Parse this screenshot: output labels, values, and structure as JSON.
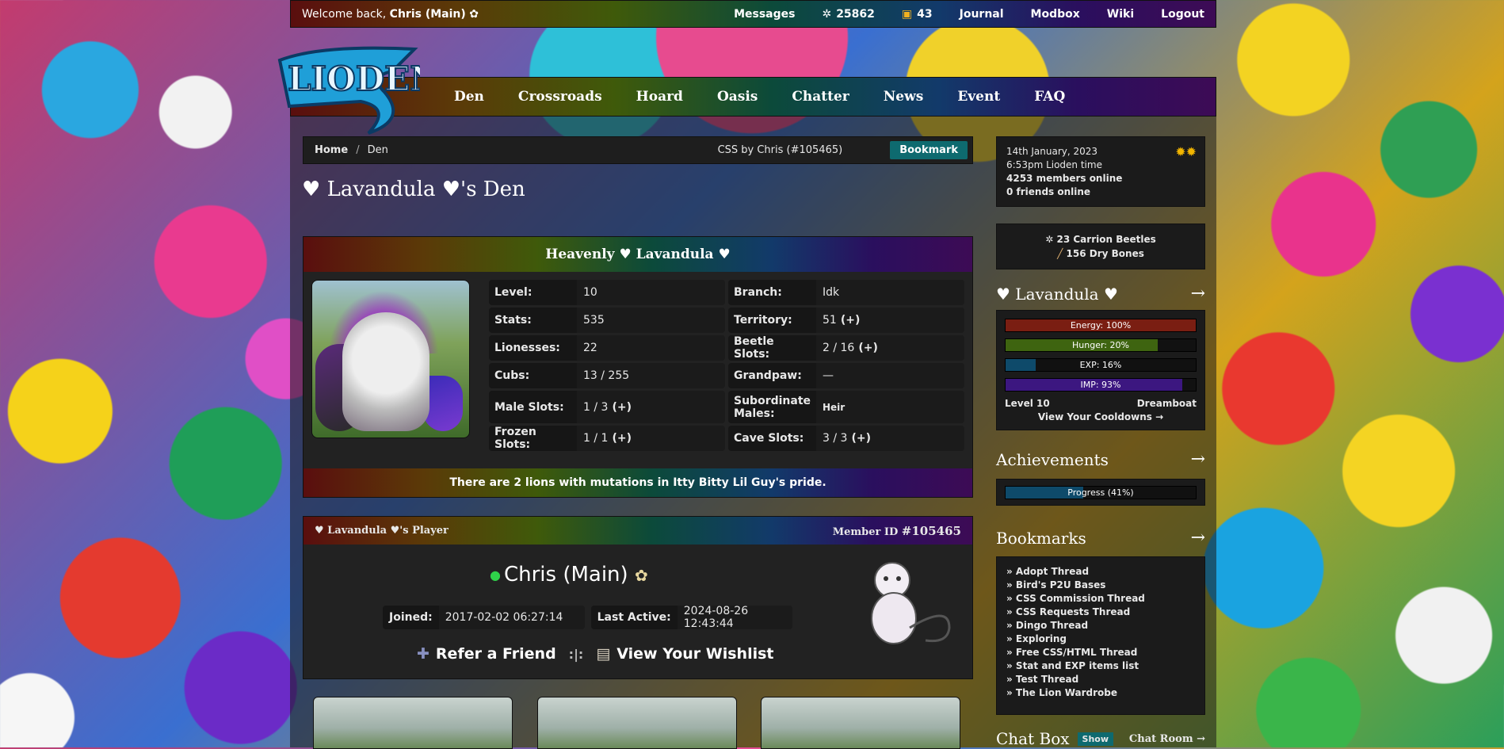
{
  "topbar": {
    "welcome_prefix": "Welcome back,",
    "user": "Chris (Main)",
    "messages": "Messages",
    "beetles": "25862",
    "gifts": "43",
    "journal": "Journal",
    "modbox": "Modbox",
    "wiki": "Wiki",
    "logout": "Logout"
  },
  "logo": {
    "text": "LIODEN"
  },
  "nav": [
    "Den",
    "Crossroads",
    "Hoard",
    "Oasis",
    "Chatter",
    "News",
    "Event",
    "FAQ"
  ],
  "crumb": {
    "home": "Home",
    "sep": "/",
    "current": "Den",
    "css": "CSS by Chris (#105465)",
    "bookmark": "Bookmark"
  },
  "page_title": "♥ Lavandula ♥'s Den",
  "king": {
    "name": "Heavenly ♥ Lavandula ♥",
    "stats": [
      [
        {
          "label": "Level:",
          "value": "10",
          "plus": ""
        },
        {
          "label": "Branch:",
          "value": "Idk",
          "plus": ""
        }
      ],
      [
        {
          "label": "Stats:",
          "value": "535",
          "plus": ""
        },
        {
          "label": "Territory:",
          "value": "51",
          "plus": "(+)"
        }
      ],
      [
        {
          "label": "Lionesses:",
          "value": "22",
          "plus": ""
        },
        {
          "label": "Beetle Slots:",
          "value": "2 / 16",
          "plus": "(+)"
        }
      ],
      [
        {
          "label": "Cubs:",
          "value": "13 / 255",
          "plus": ""
        },
        {
          "label": "Grandpaw:",
          "value": "—",
          "plus": ""
        }
      ],
      [
        {
          "label": "Male Slots:",
          "value": "1 / 3",
          "plus": "(+)"
        },
        {
          "label": "Subordinate Males:",
          "value": "Heir",
          "plus": ""
        }
      ],
      [
        {
          "label": "Frozen Slots:",
          "value": "1 / 1",
          "plus": "(+)"
        },
        {
          "label": "Cave Slots:",
          "value": "3 / 3",
          "plus": "(+)"
        }
      ]
    ],
    "mutation_note": "There are 2 lions with mutations in Itty Bitty Lil Guy's pride."
  },
  "player": {
    "header_left": "♥ Lavandula ♥'s Player",
    "member_id_label": "Member ID",
    "member_id": "#105465",
    "name": "Chris (Main)",
    "joined_label": "Joined:",
    "joined": "2017-02-02 06:27:14",
    "active_label": "Last Active:",
    "active": "2024-08-26 12:43:44",
    "refer": "Refer a Friend",
    "link_sep": ":|:",
    "wishlist": "View Your Wishlist"
  },
  "sidebar": {
    "date": "14th January, 2023",
    "time": "6:53pm Lioden time",
    "members": "4253 members online",
    "friends": "0 friends online",
    "carrion": "23 Carrion Beetles",
    "bones": "156 Dry Bones",
    "lion_name": "♥ Lavandula ♥",
    "energy": "Energy: 100%",
    "hunger": "Hunger: 20%",
    "exp": "EXP: 16%",
    "imp": "IMP: 93%",
    "level": "Level 10",
    "mood": "Dreamboat",
    "cooldowns": "View Your Cooldowns →",
    "achievements": "Achievements",
    "progress": "Progress (41%)",
    "bookmarks_title": "Bookmarks",
    "bookmarks": [
      "» Adopt Thread",
      "» Bird's P2U Bases",
      "» CSS Commission Thread",
      "» CSS Requests Thread",
      "» Dingo Thread",
      "» Exploring",
      "» Free CSS/HTML Thread",
      "» Stat and EXP items list",
      "» Test Thread",
      "» The Lion Wardrobe"
    ],
    "chat": "Chat Box",
    "show": "Show",
    "chat_room": "Chat Room →",
    "arrow": "→"
  },
  "bar_levels": {
    "energy": 1.0,
    "hunger": 0.8,
    "exp": 0.16,
    "imp": 0.93,
    "achievements": 0.41
  },
  "colors": {
    "teal": "#0e6a6f",
    "online": "#2fd24a",
    "sun": "#f2b500"
  }
}
